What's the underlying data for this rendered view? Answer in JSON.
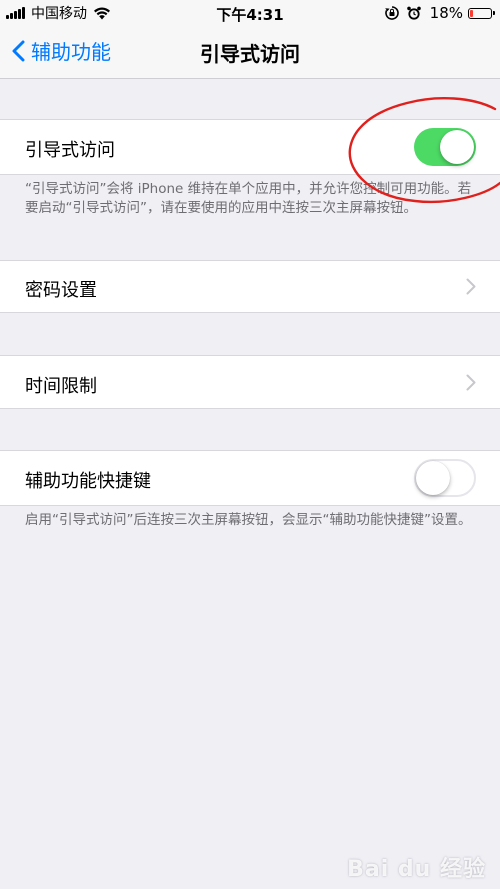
{
  "status_bar": {
    "carrier": "中国移动",
    "time": "下午4:31",
    "battery_percent": "18%",
    "battery_level": 0.18,
    "battery_color": "#ff3b30"
  },
  "nav": {
    "back_label": "辅助功能",
    "title": "引导式访问"
  },
  "guided_access": {
    "label": "引导式访问",
    "toggle_on": true,
    "description": "“引导式访问”会将 iPhone 维持在单个应用中，并允许您控制可用功能。若要启动“引导式访问”，请在要使用的应用中连按三次主屏幕按钮。"
  },
  "passcode_settings": {
    "label": "密码设置"
  },
  "time_limits": {
    "label": "时间限制"
  },
  "accessibility_shortcut": {
    "label": "辅助功能快捷键",
    "toggle_on": false,
    "description": "启用“引导式访问”后连按三次主屏幕按钮，会显示“辅助功能快捷键”设置。"
  },
  "watermark": "Bai du 经验",
  "colors": {
    "accent": "#007aff",
    "toggle_on": "#4cd964",
    "background": "#efeff4",
    "annotation": "#e0201c"
  },
  "icons": {
    "signal": "signal-bars-icon",
    "wifi": "wifi-icon",
    "rotation_lock": "rotation-lock-icon",
    "alarm": "alarm-icon",
    "battery": "battery-icon",
    "back": "chevron-left-icon",
    "disclosure": "chevron-right-icon"
  }
}
